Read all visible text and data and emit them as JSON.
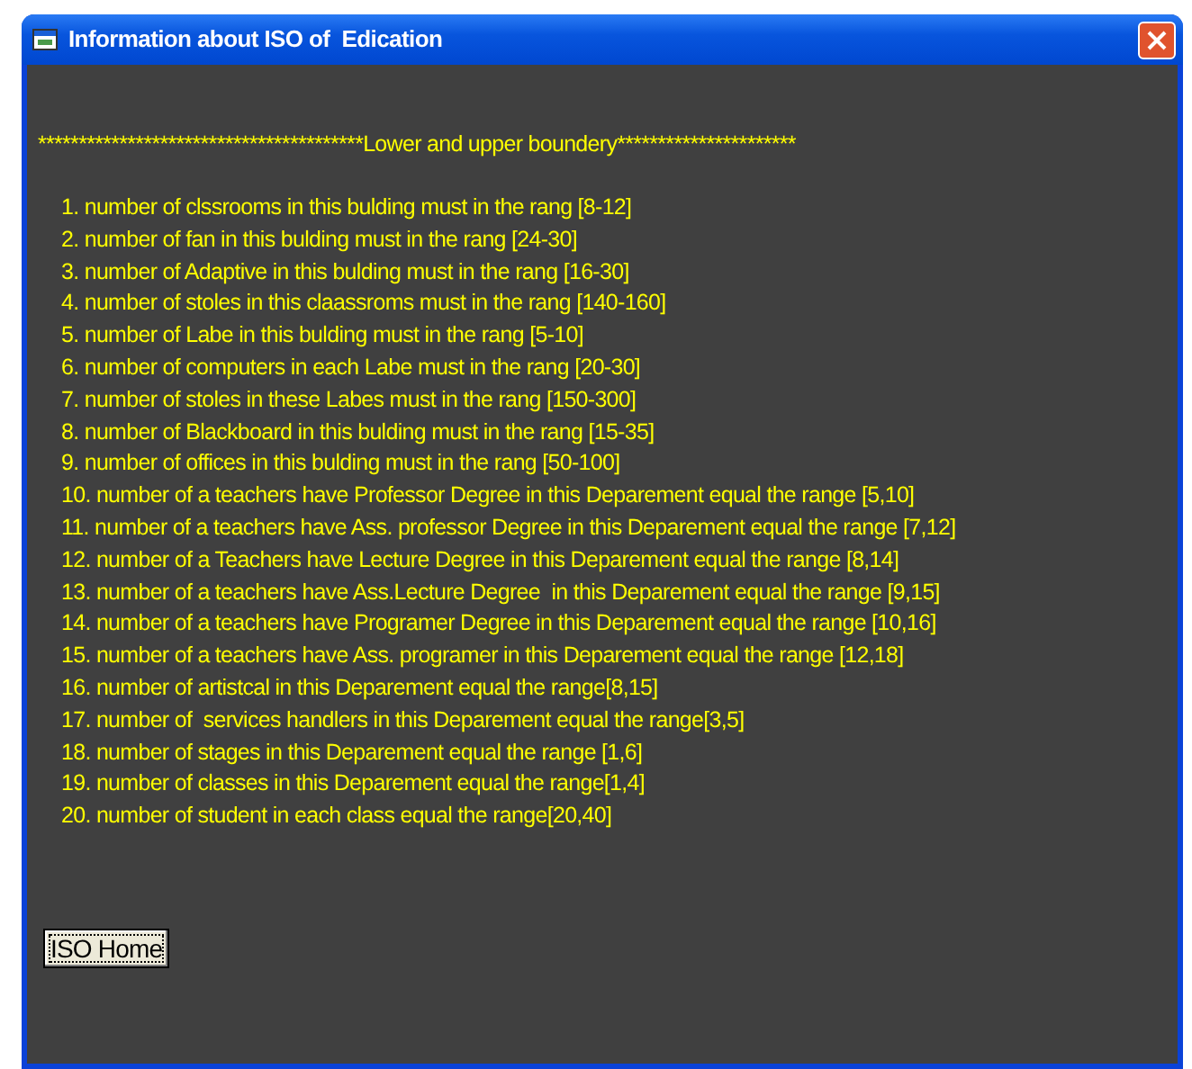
{
  "window": {
    "title": "Information about ISO of  Edication"
  },
  "heading": "****************************************Lower and upper boundery**********************",
  "items": [
    "1. number of clssrooms in this bulding must in the rang [8-12]",
    "2. number of fan in this bulding must in the rang [24-30]",
    "3. number of Adaptive in this bulding must in the rang [16-30]",
    "4. number of stoles in this claassroms must in the rang [140-160]",
    "5. number of Labe in this bulding must in the rang [5-10]",
    "6. number of computers in each Labe must in the rang [20-30]",
    "7. number of stoles in these Labes must in the rang [150-300]",
    "8. number of Blackboard in this bulding must in the rang [15-35]",
    "9. number of offices in this bulding must in the rang [50-100]",
    "10. number of a teachers have Professor Degree in this Deparement equal the range [5,10]",
    "11. number of a teachers have Ass. professor Degree in this Deparement equal the range [7,12]",
    "12. number of a Teachers have Lecture Degree in this Deparement equal the range [8,14]",
    "13. number of a teachers have Ass.Lecture Degree  in this Deparement equal the range [9,15]",
    "14. number of a teachers have Programer Degree in this Deparement equal the range [10,16]",
    "15. number of a teachers have Ass. programer in this Deparement equal the range [12,18]",
    "16. number of artistcal in this Deparement equal the range[8,15]",
    "17. number of  services handlers in this Deparement equal the range[3,5]",
    "18. number of stages in this Deparement equal the range [1,6]",
    "19. number of classes in this Deparement equal the range[1,4]",
    "20. number of student in each class equal the range[20,40]"
  ],
  "buttons": [
    "ISO Home"
  ]
}
